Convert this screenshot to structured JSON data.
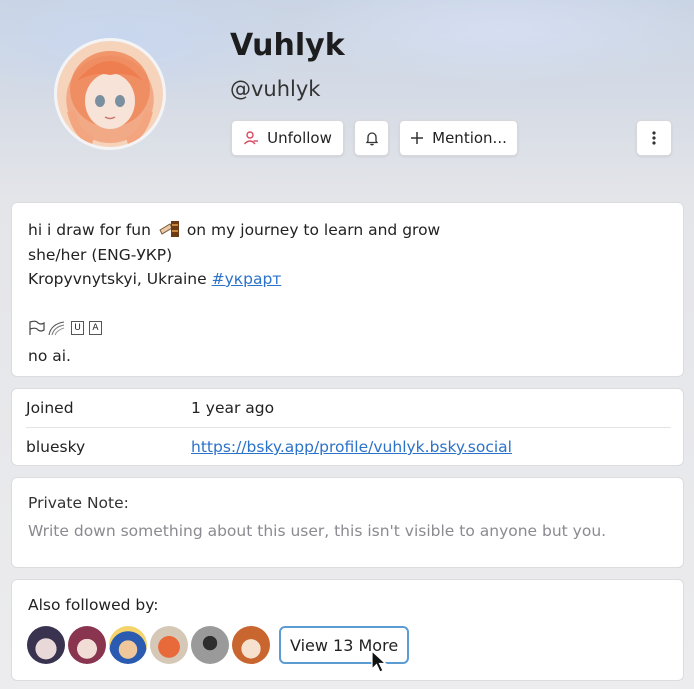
{
  "profile": {
    "display_name": "Vuhlyk",
    "handle": "@vuhlyk"
  },
  "actions": {
    "unfollow_label": "Unfollow",
    "mention_label": "Mention..."
  },
  "bio": {
    "line1_start": "hi i draw for fun",
    "line1_end": "on my journey to learn and grow",
    "line2": "she/her (ENG-УКР)",
    "line3_text": "Kropyvnytskyi, Ukraine",
    "hashtag": "#украрт",
    "key_u": "U",
    "key_a": "A",
    "line5": "no ai."
  },
  "fields": [
    {
      "key": "Joined",
      "value": "1 year ago"
    },
    {
      "key": "bluesky",
      "value": "https://bsky.app/profile/vuhlyk.bsky.social"
    }
  ],
  "note": {
    "label": "Private Note:",
    "placeholder": "Write down something about this user, this isn't visible to anyone but you."
  },
  "followed_by": {
    "label": "Also followed by:",
    "more_label": "View 13 More",
    "avatars": [
      "avatar-1",
      "avatar-2",
      "avatar-3",
      "avatar-4",
      "avatar-5",
      "avatar-6"
    ]
  },
  "colors": {
    "link": "#2b72c9",
    "unfollow_icon": "#d9485f",
    "focus_ring": "#5d9bd3"
  }
}
